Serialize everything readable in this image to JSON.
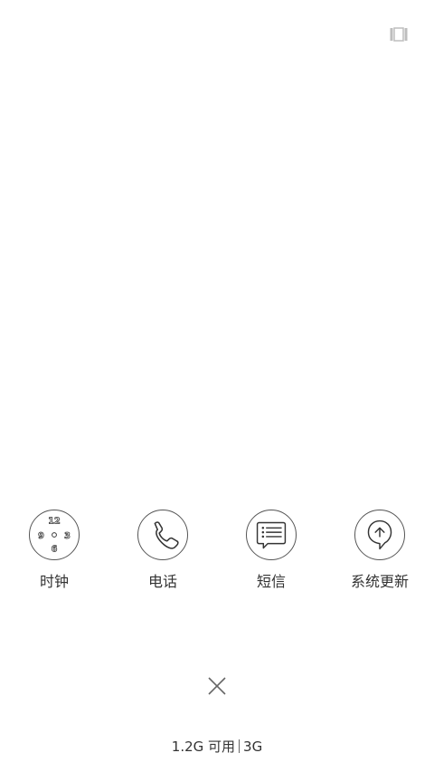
{
  "apps": [
    {
      "label": "时钟",
      "icon": "clock-icon"
    },
    {
      "label": "电话",
      "icon": "phone-icon"
    },
    {
      "label": "短信",
      "icon": "message-icon"
    },
    {
      "label": "系统更新",
      "icon": "system-update-icon"
    }
  ],
  "clock_numbers": {
    "n12": "12",
    "n3": "3",
    "n6": "6",
    "n9": "9"
  },
  "memory": {
    "available": "1.2G 可用",
    "total": "3G"
  },
  "icons": {
    "top_right": "recent-apps-icon",
    "close": "close-icon"
  }
}
